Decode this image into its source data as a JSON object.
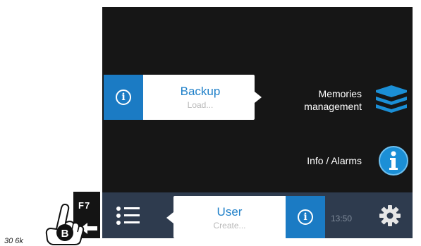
{
  "popups": {
    "backup": {
      "label": "Backup",
      "sublabel": "Load..."
    },
    "user": {
      "label": "User",
      "sublabel": "Create..."
    }
  },
  "menu": {
    "memories": {
      "line1": "Memories",
      "line2": "management",
      "icon": "layers-icon"
    },
    "info_alarms": {
      "label": "Info / Alarms",
      "icon": "info-icon"
    }
  },
  "bottom_bar": {
    "time": "13:50",
    "list_icon": "list-icon",
    "settings_icon": "gear-icon"
  },
  "side_key": {
    "label": "F7"
  },
  "callout": {
    "letter": "B"
  },
  "page_fragment": "30 6k",
  "colors": {
    "accent": "#1b7bc4",
    "screen_bg": "#161616",
    "bar_bg": "#2e3b4e"
  }
}
